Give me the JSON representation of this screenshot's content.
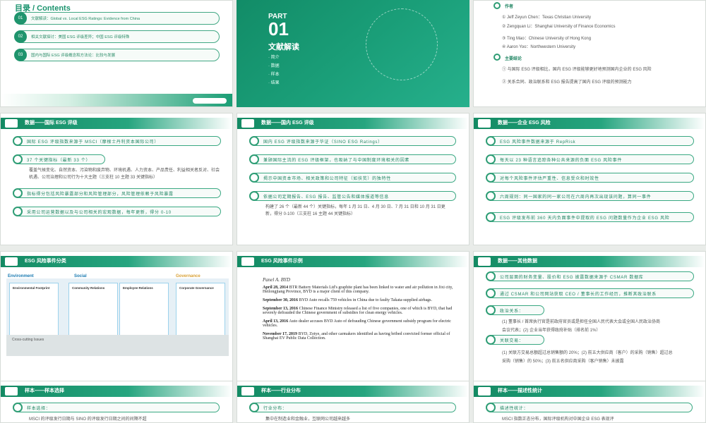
{
  "slide_a": {
    "title": "目录 / Contents",
    "items": [
      {
        "num": "01",
        "text": "文献解读：Global vs. Local ESG Ratings: Evidence from China"
      },
      {
        "num": "02",
        "text": "相关文献探讨：美国 ESG 评级差异；中国 ESG 评级特殊"
      },
      {
        "num": "03",
        "text": "国内与国际 ESG 评级概念和方法论：比较与发展"
      }
    ]
  },
  "slide_b": {
    "part_label": "PART",
    "part_num": "01",
    "part_title": "文献解读",
    "list": [
      "· 简介",
      "· 数据",
      "· 样本",
      "· 结果"
    ]
  },
  "slide_c": {
    "author_label": "作者",
    "authors": [
      "①  Jeff Zeyun Chen：Texas Christian University",
      "②  Zengquan Li：Shanghai University of Finance Economics",
      "③  Ting Mao：Chinese University of Hong Kong",
      "④  Aaron Yoo：Northwestern University"
    ],
    "conclusion_label": "主要结论",
    "conclusions": [
      "①  与国际 ESG 评级相比，国内 ESG 评级能够更好地预测国内企业的 ESG 风险",
      "②  关系合同、政治联系和 ESG 报告提高了国内 ESG 评级的预测能力"
    ]
  },
  "mid_1": {
    "title": "数据——国际 ESG 评级",
    "rows": [
      "国际 ESG 评级指数来源于 MSCI（摩根士丹利资本国际公司）",
      "37 个关键指标（最新 33 个）",
      "覆盖气候变化、自然资本、污染物和废弃物、环境机遇、人力资本、产品责任、利益相关者反对、社会机遇、公司治理和公司行为十大主题（三支柱 10 主题 33 关键指标）",
      "指标得分包括风险暴露部分和风险管理部分，风险管理依赖于风险暴露",
      "采用公司运营数据以及与公司相关的宏观数据，每年更新，得分 0-10"
    ]
  },
  "mid_2": {
    "title": "数据——国内 ESG 评级",
    "rows": [
      "国内 ESG 评级指数来源于华证（SINO ESG Ratings）",
      "兼顾国际主流的 ESG 评级框架，也吸纳了与中国制度环境相关的因素",
      "揭示中国资本市场、相关政策和公司特征（如扶贫）的独特性",
      "依据公司定期报告、ESG 报告、监管公告和媒体报道等信息",
      "构建了 26 个（最新 44 个）关键指标，每年 1 月 31 日、4 月 30 日、7 月 31 日和 10 月 31 日更新，得分 0-100（三支柱 16 主题 44 关键指标）"
    ]
  },
  "mid_3": {
    "title": "数据——企业 ESG 风险",
    "rows": [
      "ESG 风险事件数据来源于 RepRisk",
      "每天以 23 种语言追踪各种公共来源的负面 ESG 风险事件",
      "对每个风险事件评估严重性、信息受众和时效性",
      "六周规则：同一国家的同一家公司在六周内再次出现该问题，算同一事件",
      "ESG 评级发布前 360 天内负面事件中提取的 ESG 问题数量作为企业 ESG 风险"
    ]
  },
  "low_1": {
    "title": "ESG 风险事件分类",
    "env_head": "Environment",
    "social_head": "Social",
    "gov_head": "Governance",
    "env_col": "Environmental Footprint",
    "community_col": "Community Relations",
    "employee_col": "Employee Relations",
    "corporate_col": "Corporate Governance",
    "cross_title": "Cross-cutting Issues"
  },
  "low_2": {
    "title": "ESG 风险事件示例",
    "panel": "Panel A. BYD",
    "events": [
      {
        "date": "April 28, 2014",
        "text": "BTR Battery Materials Ltd's graphite plant has been linked to water and air pollution in Jixi city, Heilongjiang Province, BYD is a major client of this company."
      },
      {
        "date": "September 30, 2016",
        "text": "BYD Auto recalls 759 vehicles in China due to faulty Takata-supplied airbags."
      },
      {
        "date": "September 13, 2016",
        "text": "Chinese Finance Ministry released a list of five companies, one of which is BYD, that had severely defrauded the Chinese government of subsidies for clean energy vehicles."
      },
      {
        "date": "April 13, 2016",
        "text": "Auto dealer accuses BYD Auto of defrauding Chinese government subsidy program for electric vehicles."
      },
      {
        "date": "November 17, 2019",
        "text": "BYD, Zotye, and other carmakers identified as having bribed convicted former official of Shanghai EV Public Data Collection."
      }
    ]
  },
  "low_3": {
    "title": "数据——其他数据",
    "rows": [
      "公司层面的财务变量、股价和 ESG 披露数据来源于 CSMAR 数据库",
      "通过 CSMAR 和公司网站获取 CEO / 董事长的工作经历，推断其政治联系",
      "政治关系：",
      "(1) 董事长 / 首席执行官是前政府官员或是担任全国人民代表大会或全国人民政治协商",
      "会议代表；(2) 企业当年获得政府补贴（排名前 1%）",
      "关联交易：",
      "(1) 关联方交易总额超过总销售额的 20%；(2) 前五大供应商（客户）的采购（销售）超过总",
      "采购（销售）的 50%；(3) 前五名供应商采购（客户销售）未披露"
    ]
  },
  "bot_1": {
    "title": "样本——样本选择",
    "row": "样本选择：",
    "sub": "MSCI 的评级发行日期与 SINO 的评级发行日期之间的间隔不超"
  },
  "bot_2": {
    "title": "样本——行业分布",
    "row": "行业分布：",
    "sub": "集中在制造业和金融业，互联网公司越来越多"
  },
  "bot_3": {
    "title": "样本——描述性统计",
    "row": "描述性统计：",
    "sub": "MSCI 指数正态分布，国际评级机构对中国企业 ESG 表现评"
  }
}
